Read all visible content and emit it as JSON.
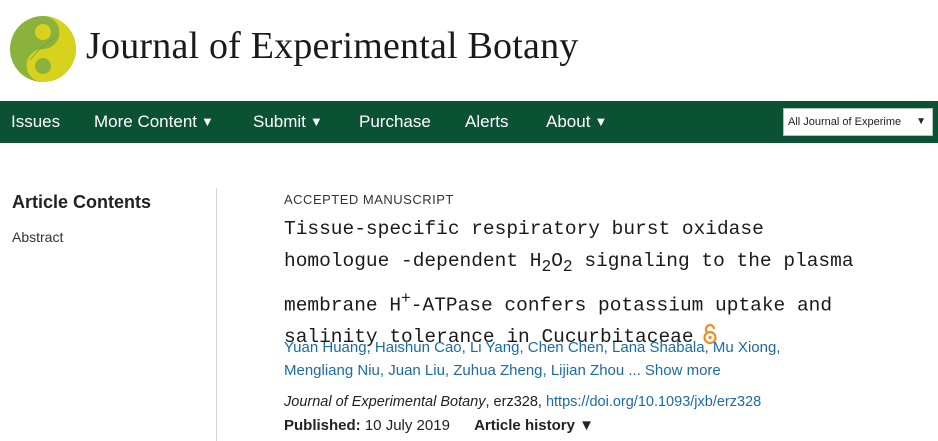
{
  "header": {
    "journal_title": "Journal of Experimental Botany"
  },
  "nav": {
    "items": [
      {
        "label": "Issues",
        "caret": ""
      },
      {
        "label": "More Content",
        "caret": "▼"
      },
      {
        "label": "Submit",
        "caret": "▼"
      },
      {
        "label": "Purchase",
        "caret": ""
      },
      {
        "label": "Alerts",
        "caret": ""
      },
      {
        "label": "About",
        "caret": "▼"
      }
    ],
    "search_scope": "All Journal of Experime",
    "search_scope_caret": "▼"
  },
  "sidebar": {
    "title": "Article Contents",
    "items": [
      {
        "label": "Abstract"
      }
    ]
  },
  "article": {
    "badge": "ACCEPTED MANUSCRIPT",
    "title_lines": [
      "Tissue-specific respiratory burst oxidase",
      "homologue -dependent H",
      "2",
      "O",
      "2",
      " signaling to the plasma",
      "membrane H",
      "+",
      "-ATPase confers potassium uptake and",
      "salinity tolerance in Cucurbitaceae"
    ],
    "authors_line1": "Yuan Huang, Haishun Cao, Li Yang, Chen Chen, Lana Shabala, Mu Xiong,",
    "authors_line2": "Mengliang Niu, Juan Liu, Zuhua Zheng, Lijian Zhou ...",
    "show_more": "Show more",
    "citation_journal": "Journal of Experimental Botany",
    "citation_id": ", erz328,",
    "doi": "https://doi.org/10.1093/jxb/erz328",
    "published_label": "Published:",
    "published_date": "10 July 2019",
    "history_label": "Article history",
    "history_caret": "▼"
  },
  "colors": {
    "nav_bg": "#0b5134",
    "link": "#1a6aa8",
    "open_access": "#f08a24",
    "logo_yellow": "#d8d21f",
    "logo_green": "#6f9e3a"
  }
}
